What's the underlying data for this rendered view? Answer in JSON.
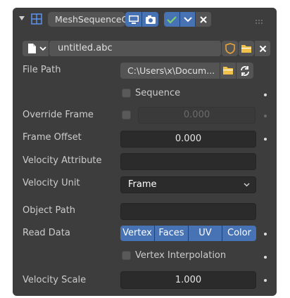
{
  "header": {
    "modifier_name": "MeshSequenceCa...",
    "icons": [
      "collapse-arrow-icon",
      "grid-icon",
      "realtime-icon",
      "render-icon",
      "check-icon",
      "chevron-down-icon",
      "close-icon",
      "drag-handle-icon"
    ]
  },
  "cache_file": {
    "name": "untitled.abc",
    "icons": [
      "file-icon",
      "shield-icon",
      "folder-icon",
      "close-icon"
    ]
  },
  "rows": {
    "file_path": {
      "label": "File Path",
      "value": "C:\\Users\\x\\Docum..."
    },
    "sequence": {
      "label": "Sequence"
    },
    "override_frame": {
      "label": "Override Frame",
      "value": "0.000"
    },
    "frame_offset": {
      "label": "Frame Offset",
      "value": "0.000"
    },
    "velocity_attribute": {
      "label": "Velocity Attribute",
      "value": ""
    },
    "velocity_unit": {
      "label": "Velocity Unit",
      "value": "Frame"
    },
    "object_path": {
      "label": "Object Path",
      "value": ""
    },
    "read_data": {
      "label": "Read Data",
      "options": [
        "Vertex",
        "Faces",
        "UV",
        "Color"
      ]
    },
    "vertex_interpolation": {
      "label": "Vertex Interpolation"
    },
    "velocity_scale": {
      "label": "Velocity Scale",
      "value": "1.000"
    }
  },
  "colors": {
    "accent": "#4772b3",
    "panel": "#3d3d3d",
    "field": "#545454",
    "dark_field": "#2b2b2b",
    "checkbox_active": "#4a8a3a"
  }
}
